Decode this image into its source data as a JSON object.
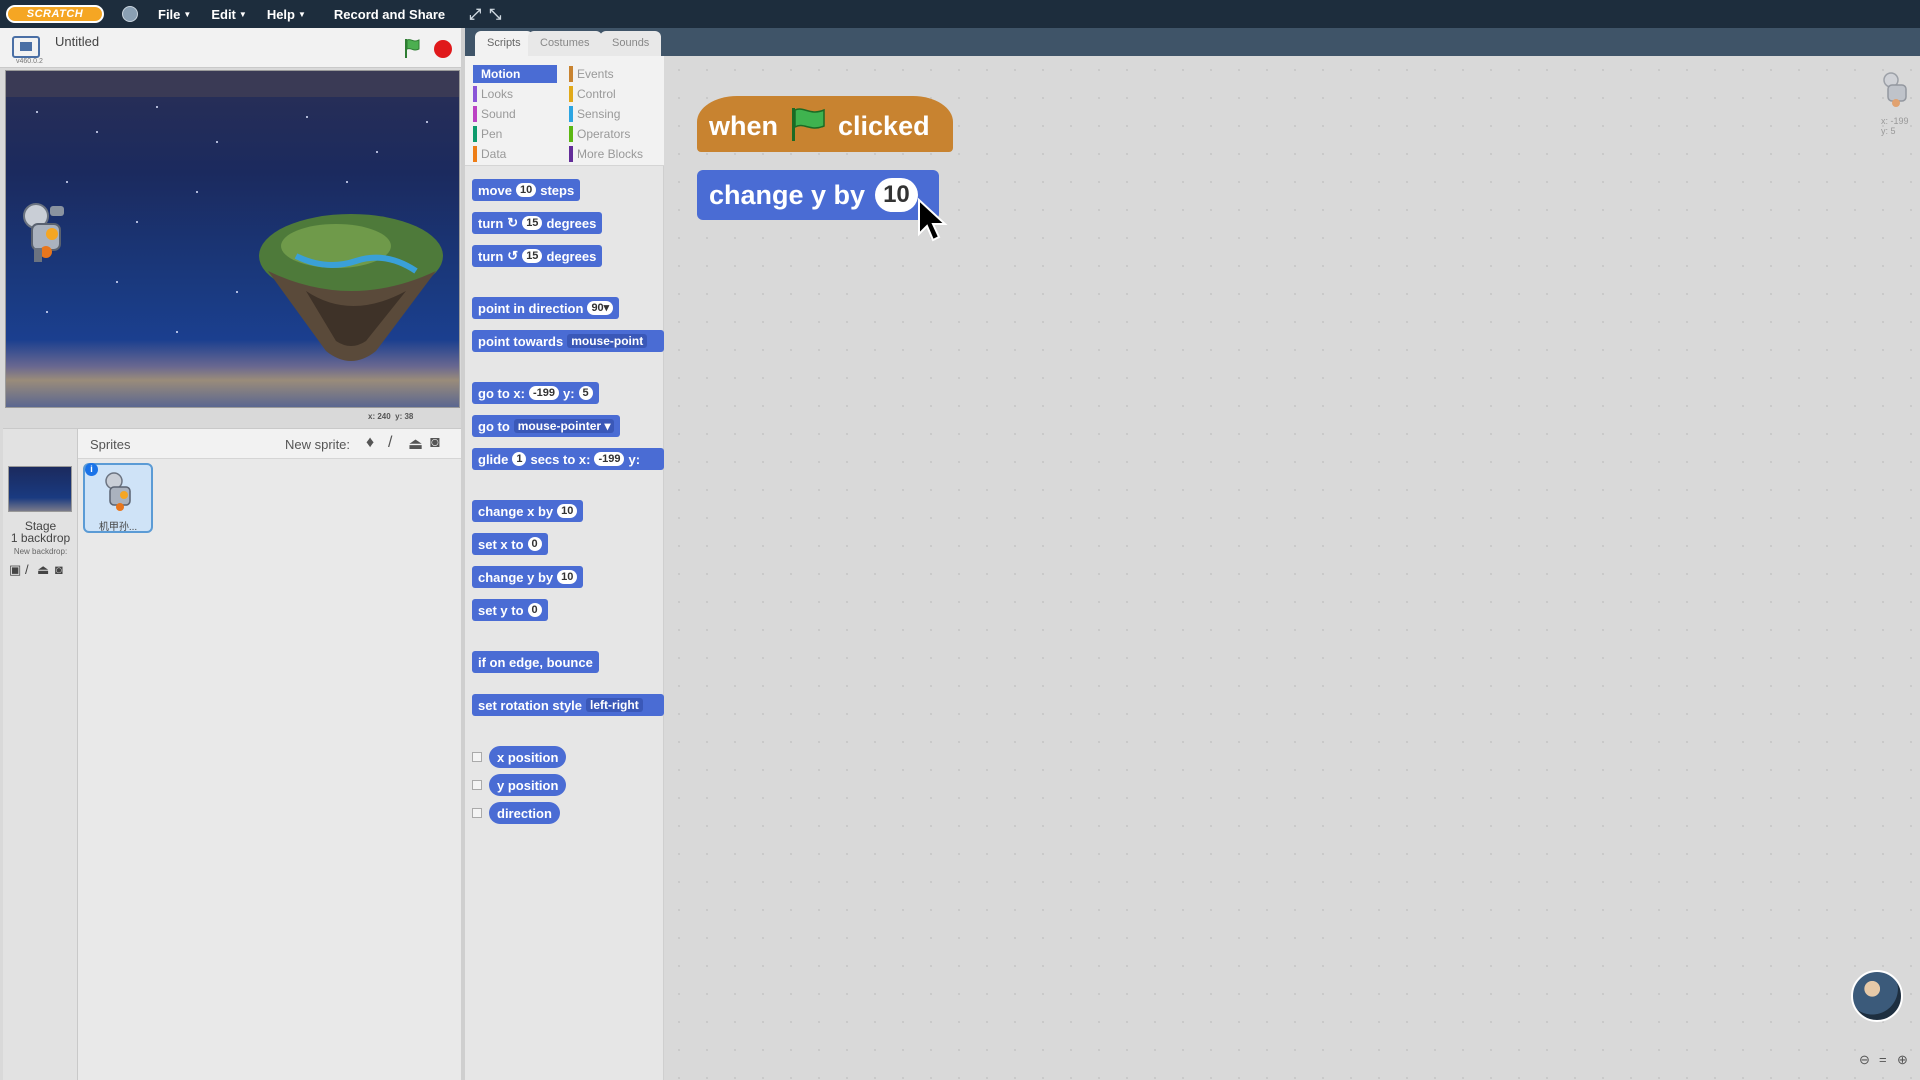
{
  "menubar": {
    "logo_text": "SCRATCH",
    "items": [
      {
        "label": "File",
        "has_caret": true
      },
      {
        "label": "Edit",
        "has_caret": true
      },
      {
        "label": "Help",
        "has_caret": true
      }
    ],
    "record_share": "Record and Share",
    "fullscreen_icon": "expand-arrows-icon",
    "small_stage_icon": "shrink-arrows-icon"
  },
  "stage_header": {
    "version": "v460.0.2",
    "title": "Untitled"
  },
  "stage": {
    "mouse_x_label": "x: 240",
    "mouse_y_label": "y: 38"
  },
  "sprites_pane": {
    "header_label": "Sprites",
    "new_sprite_label": "New sprite:",
    "stage_name": "Stage",
    "backdrop_count": "1 backdrop",
    "new_backdrop_label": "New backdrop:",
    "sprite": {
      "name": "机甲孙...",
      "info_badge": "i"
    }
  },
  "tabs": [
    "Scripts",
    "Costumes",
    "Sounds"
  ],
  "categories": {
    "left": [
      {
        "label": "Motion",
        "color": "#4a6cd4",
        "active": true
      },
      {
        "label": "Looks",
        "color": "#8a55d7"
      },
      {
        "label": "Sound",
        "color": "#bb42c3"
      },
      {
        "label": "Pen",
        "color": "#0e9a6c"
      },
      {
        "label": "Data",
        "color": "#ee7d16"
      }
    ],
    "right": [
      {
        "label": "Events",
        "color": "#c88330"
      },
      {
        "label": "Control",
        "color": "#e1a91a"
      },
      {
        "label": "Sensing",
        "color": "#2ca5e2"
      },
      {
        "label": "Operators",
        "color": "#5cb712"
      },
      {
        "label": "More Blocks",
        "color": "#632d99"
      }
    ]
  },
  "palette_blocks": {
    "move": {
      "pre": "move",
      "value": "10",
      "post": "steps"
    },
    "turn_cw": {
      "pre": "turn",
      "icon": "↻",
      "value": "15",
      "post": "degrees"
    },
    "turn_ccw": {
      "pre": "turn",
      "icon": "↺",
      "value": "15",
      "post": "degrees"
    },
    "point_dir": {
      "pre": "point in direction",
      "value": "90▾"
    },
    "point_towards": {
      "pre": "point towards",
      "value": "mouse-point"
    },
    "goto_xy": {
      "pre": "go to x:",
      "x": "-199",
      "mid": "y:",
      "y": "5"
    },
    "goto": {
      "pre": "go to",
      "value": "mouse-pointer ▾"
    },
    "glide": {
      "pre": "glide",
      "secs": "1",
      "mid": "secs to x:",
      "x": "-199",
      "post": "y:"
    },
    "change_x": {
      "pre": "change x by",
      "value": "10"
    },
    "set_x": {
      "pre": "set x to",
      "value": "0"
    },
    "change_y": {
      "pre": "change y by",
      "value": "10"
    },
    "set_y": {
      "pre": "set y to",
      "value": "0"
    },
    "bounce": {
      "pre": "if on edge, bounce"
    },
    "rotation_style": {
      "pre": "set rotation style",
      "value": "left-right"
    },
    "reporters": [
      "x position",
      "y position",
      "direction"
    ]
  },
  "script": {
    "hat": {
      "pre": "when",
      "post": "clicked"
    },
    "motion": {
      "pre": "change y by",
      "value": "10"
    }
  },
  "scripts_area": {
    "ghost_x": "x: -199",
    "ghost_y": "y: 5",
    "zoom_out_icon": "zoom-out-icon",
    "zoom_reset_icon": "equals-icon",
    "zoom_in_icon": "zoom-in-icon"
  }
}
